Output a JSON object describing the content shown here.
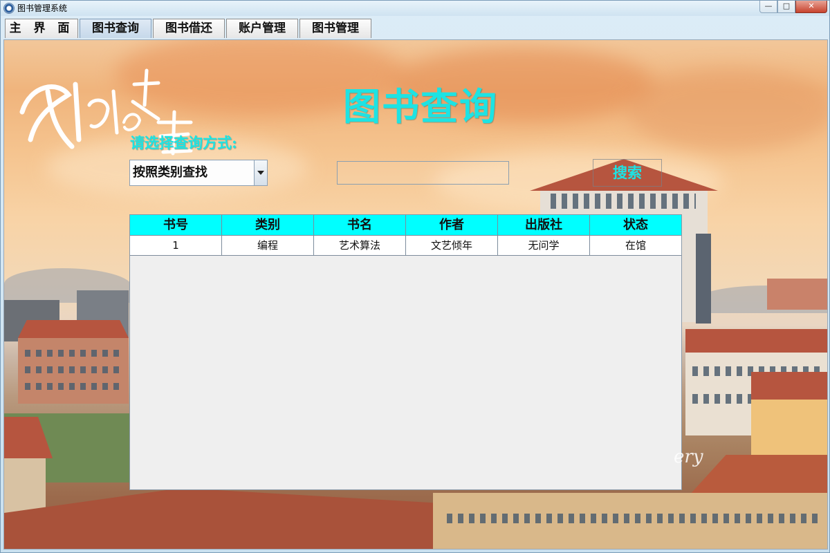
{
  "window": {
    "title": "图书管理系统",
    "controls": {
      "minimize_glyph": "—",
      "maximize_glyph": "□",
      "close_glyph": "✕"
    }
  },
  "tabs": [
    {
      "label": "主 界 面",
      "active": false
    },
    {
      "label": "图书查询",
      "active": true
    },
    {
      "label": "图书借还",
      "active": false
    },
    {
      "label": "账户管理",
      "active": false
    },
    {
      "label": "图书管理",
      "active": false
    }
  ],
  "decor": {
    "calligraphy": "我们的大理",
    "signature": "ery"
  },
  "page": {
    "title": "图书查询",
    "prompt_label": "请选择查询方式:"
  },
  "search": {
    "mode_selected": "按照类别查找",
    "query_value": "",
    "button_label": "搜索"
  },
  "table": {
    "columns": [
      "书号",
      "类别",
      "书名",
      "作者",
      "出版社",
      "状态"
    ],
    "rows": [
      [
        "1",
        "编程",
        "艺术算法",
        "文艺倾年",
        "无问学",
        "在馆"
      ]
    ]
  },
  "colors": {
    "accent_text": "#1de3e3",
    "table_header_bg": "#00ffff",
    "table_body_bg": "#efefef",
    "close_button": "#c7432e"
  },
  "icons": {
    "app_icon": "app-logo-icon",
    "dropdown": "chevron-down-icon"
  }
}
